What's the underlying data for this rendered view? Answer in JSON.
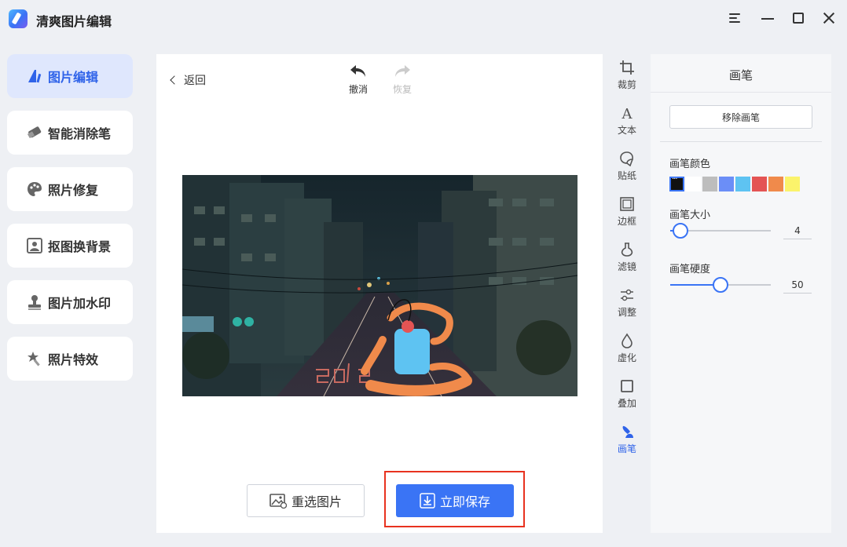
{
  "app": {
    "title": "清爽图片编辑"
  },
  "nav": {
    "items": [
      {
        "label": "图片编辑",
        "icon": "image-edit-icon"
      },
      {
        "label": "智能消除笔",
        "icon": "eraser-icon"
      },
      {
        "label": "照片修复",
        "icon": "palette-icon"
      },
      {
        "label": "抠图换背景",
        "icon": "portrait-icon"
      },
      {
        "label": "图片加水印",
        "icon": "stamp-icon"
      },
      {
        "label": "照片特效",
        "icon": "magic-wand-icon"
      }
    ]
  },
  "toolbar": {
    "back_label": "返回",
    "undo_label": "撤消",
    "redo_label": "恢复"
  },
  "actions": {
    "reselect_label": "重选图片",
    "save_label": "立即保存"
  },
  "tools": [
    {
      "label": "裁剪",
      "icon": "crop-icon"
    },
    {
      "label": "文本",
      "icon": "text-icon"
    },
    {
      "label": "贴纸",
      "icon": "sticker-icon"
    },
    {
      "label": "边框",
      "icon": "frame-icon"
    },
    {
      "label": "滤镜",
      "icon": "filter-icon"
    },
    {
      "label": "调整",
      "icon": "adjust-icon"
    },
    {
      "label": "虚化",
      "icon": "blur-icon"
    },
    {
      "label": "叠加",
      "icon": "overlay-icon"
    },
    {
      "label": "画笔",
      "icon": "brush-icon"
    }
  ],
  "brush_panel": {
    "title": "画笔",
    "remove_label": "移除画笔",
    "color_label": "画笔颜色",
    "colors": [
      "#111111",
      "#ffffff",
      "#bdbdbd",
      "#6b8ef7",
      "#5ec3f2",
      "#e45454",
      "#f08a4b",
      "#fbf36b"
    ],
    "selected_color": "#111111",
    "size_label": "画笔大小",
    "size_value": "4",
    "size_fraction": 0.1,
    "hardness_label": "画笔硬度",
    "hardness_value": "50",
    "hardness_fraction": 0.5
  },
  "accent_color": "#3a74f5",
  "highlight_color": "#e8321f"
}
